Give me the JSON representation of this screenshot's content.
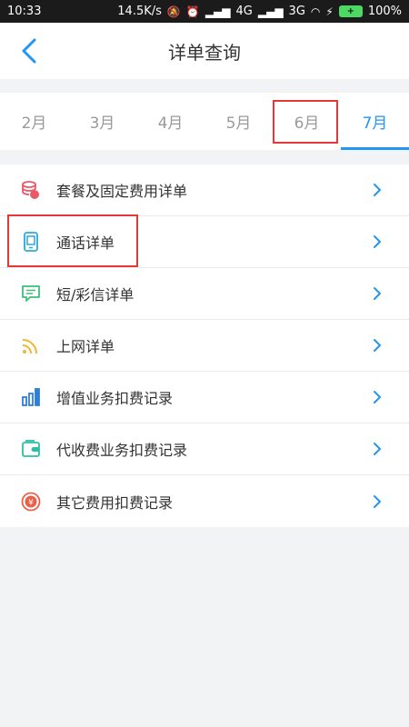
{
  "status_bar": {
    "time": "10:33",
    "speed": "14.5K/s",
    "net1": "4G",
    "net2": "3G",
    "battery": "100%"
  },
  "header": {
    "title": "详单查询"
  },
  "months": {
    "tabs": [
      "2月",
      "3月",
      "4月",
      "5月",
      "6月",
      "7月"
    ],
    "active_index": 5
  },
  "menu": {
    "items": [
      {
        "label": "套餐及固定费用详单",
        "icon": "coins-icon",
        "color": "#e8596a"
      },
      {
        "label": "通话详单",
        "icon": "phone-icon",
        "color": "#2aa9e0"
      },
      {
        "label": "短/彩信详单",
        "icon": "message-icon",
        "color": "#3cbf7a"
      },
      {
        "label": "上网详单",
        "icon": "wifi-icon",
        "color": "#f2b632"
      },
      {
        "label": "增值业务扣费记录",
        "icon": "bar-chart-icon",
        "color": "#2f7fd8"
      },
      {
        "label": "代收费业务扣费记录",
        "icon": "wallet-icon",
        "color": "#2bbfa5"
      },
      {
        "label": "其它费用扣费记录",
        "icon": "yuan-coin-icon",
        "color": "#e8604a"
      }
    ]
  },
  "colors": {
    "accent": "#2196f3",
    "highlight": "#e53935"
  }
}
